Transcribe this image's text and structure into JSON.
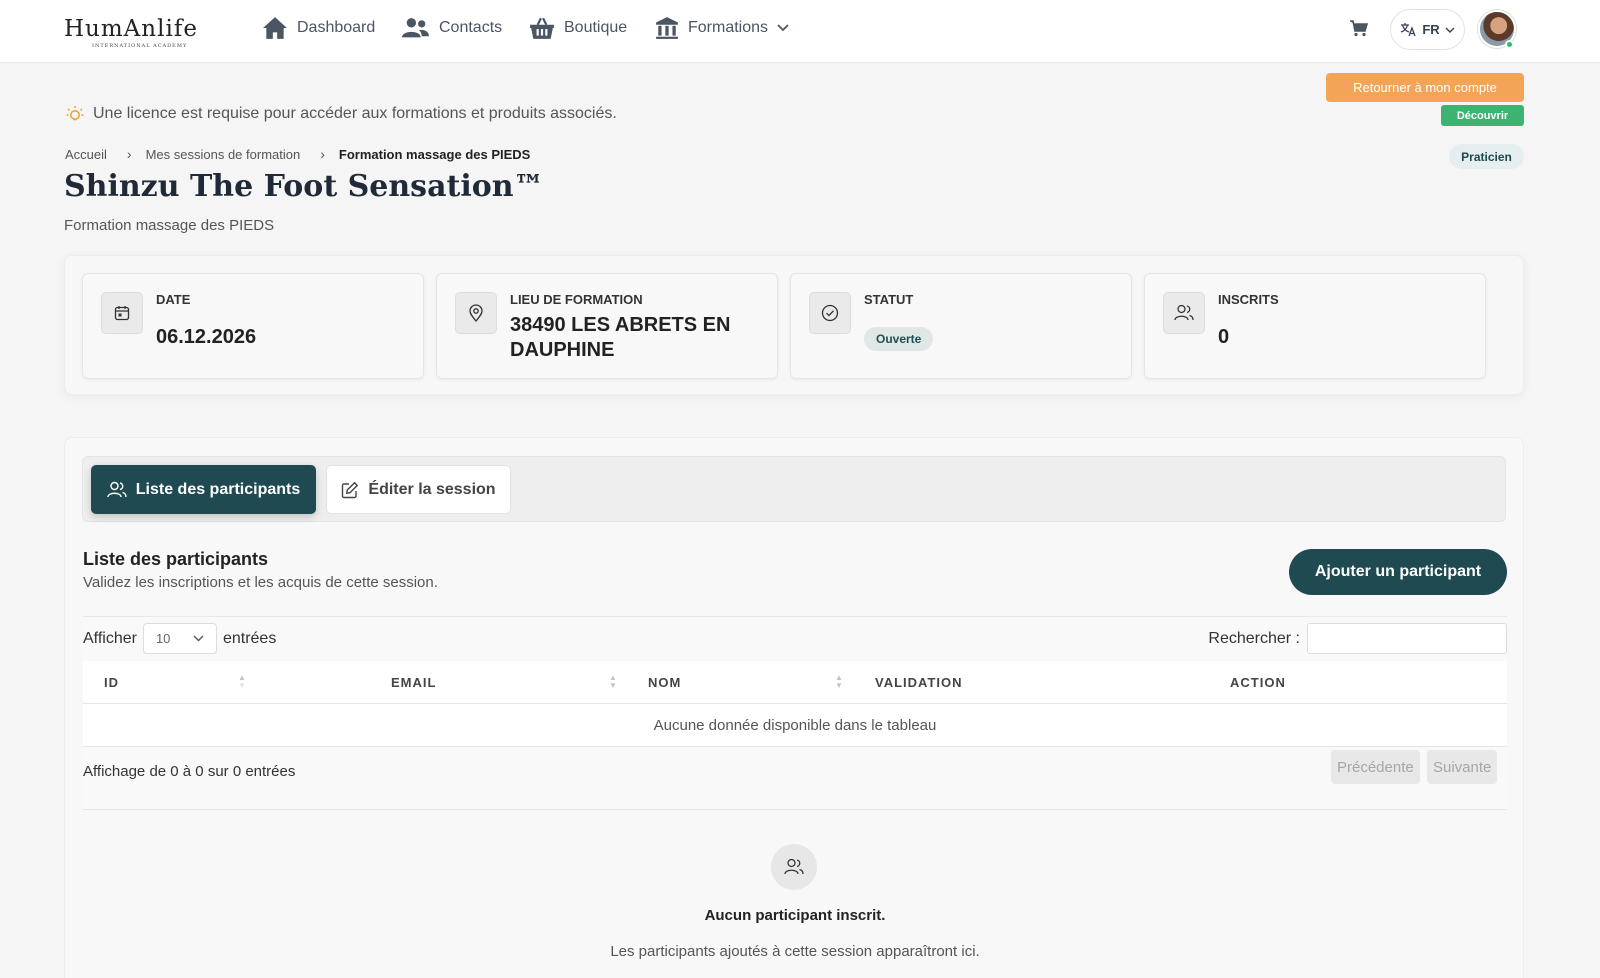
{
  "brand": {
    "logo_word": "HumAnlife",
    "logo_sub": "INTERNATIONAL ACADEMY"
  },
  "nav": {
    "items": [
      {
        "label": "Dashboard",
        "icon": "home-icon"
      },
      {
        "label": "Contacts",
        "icon": "users-icon"
      },
      {
        "label": "Boutique",
        "icon": "basket-icon"
      },
      {
        "label": "Formations",
        "icon": "institution-icon"
      }
    ],
    "language": "FR"
  },
  "notices": {
    "return_button": "Retourner à mon compte",
    "discover_button": "Découvrir",
    "license_text": "Une licence est requise pour accéder aux formations et produits associés."
  },
  "breadcrumb": {
    "items": [
      "Accueil",
      "Mes sessions de formation",
      "Formation massage des PIEDS"
    ]
  },
  "role_badge": "Praticien",
  "page": {
    "title": "Shinzu The Foot Sensation™",
    "subtitle": "Formation massage des PIEDS"
  },
  "cards": {
    "date": {
      "label": "DATE",
      "value": "06.12.2026",
      "icon": "calendar-icon"
    },
    "location": {
      "label": "LIEU DE FORMATION",
      "value": "38490 LES ABRETS EN DAUPHINE",
      "icon": "map-pin-icon"
    },
    "status": {
      "label": "STATUT",
      "value": "Ouverte",
      "icon": "check-circle-icon"
    },
    "enrolled": {
      "label": "INSCRITS",
      "value": "0",
      "icon": "users-icon"
    }
  },
  "tabs": {
    "participants": "Liste des participants",
    "edit": "Éditer la session"
  },
  "section": {
    "title": "Liste des participants",
    "subtitle": "Validez les inscriptions et les acquis de cette session.",
    "add_button": "Ajouter un participant"
  },
  "table": {
    "show_label": "Afficher",
    "page_length": "10",
    "entries_label": "entrées",
    "search_label": "Rechercher :",
    "search_value": "",
    "columns": [
      "ID",
      "EMAIL",
      "NOM",
      "VALIDATION",
      "ACTION"
    ],
    "empty_message": "Aucune donnée disponible dans le tableau",
    "info": "Affichage de 0 à 0 sur 0 entrées",
    "prev": "Précédente",
    "next": "Suivante"
  },
  "empty_state": {
    "title": "Aucun participant inscrit.",
    "subtitle": "Les participants ajoutés à cette session apparaîtront ici."
  },
  "colors": {
    "primary": "#1f4a52",
    "return_orange": "#f4a457",
    "discover_green": "#3cb371",
    "online_dot": "#22c55e"
  }
}
